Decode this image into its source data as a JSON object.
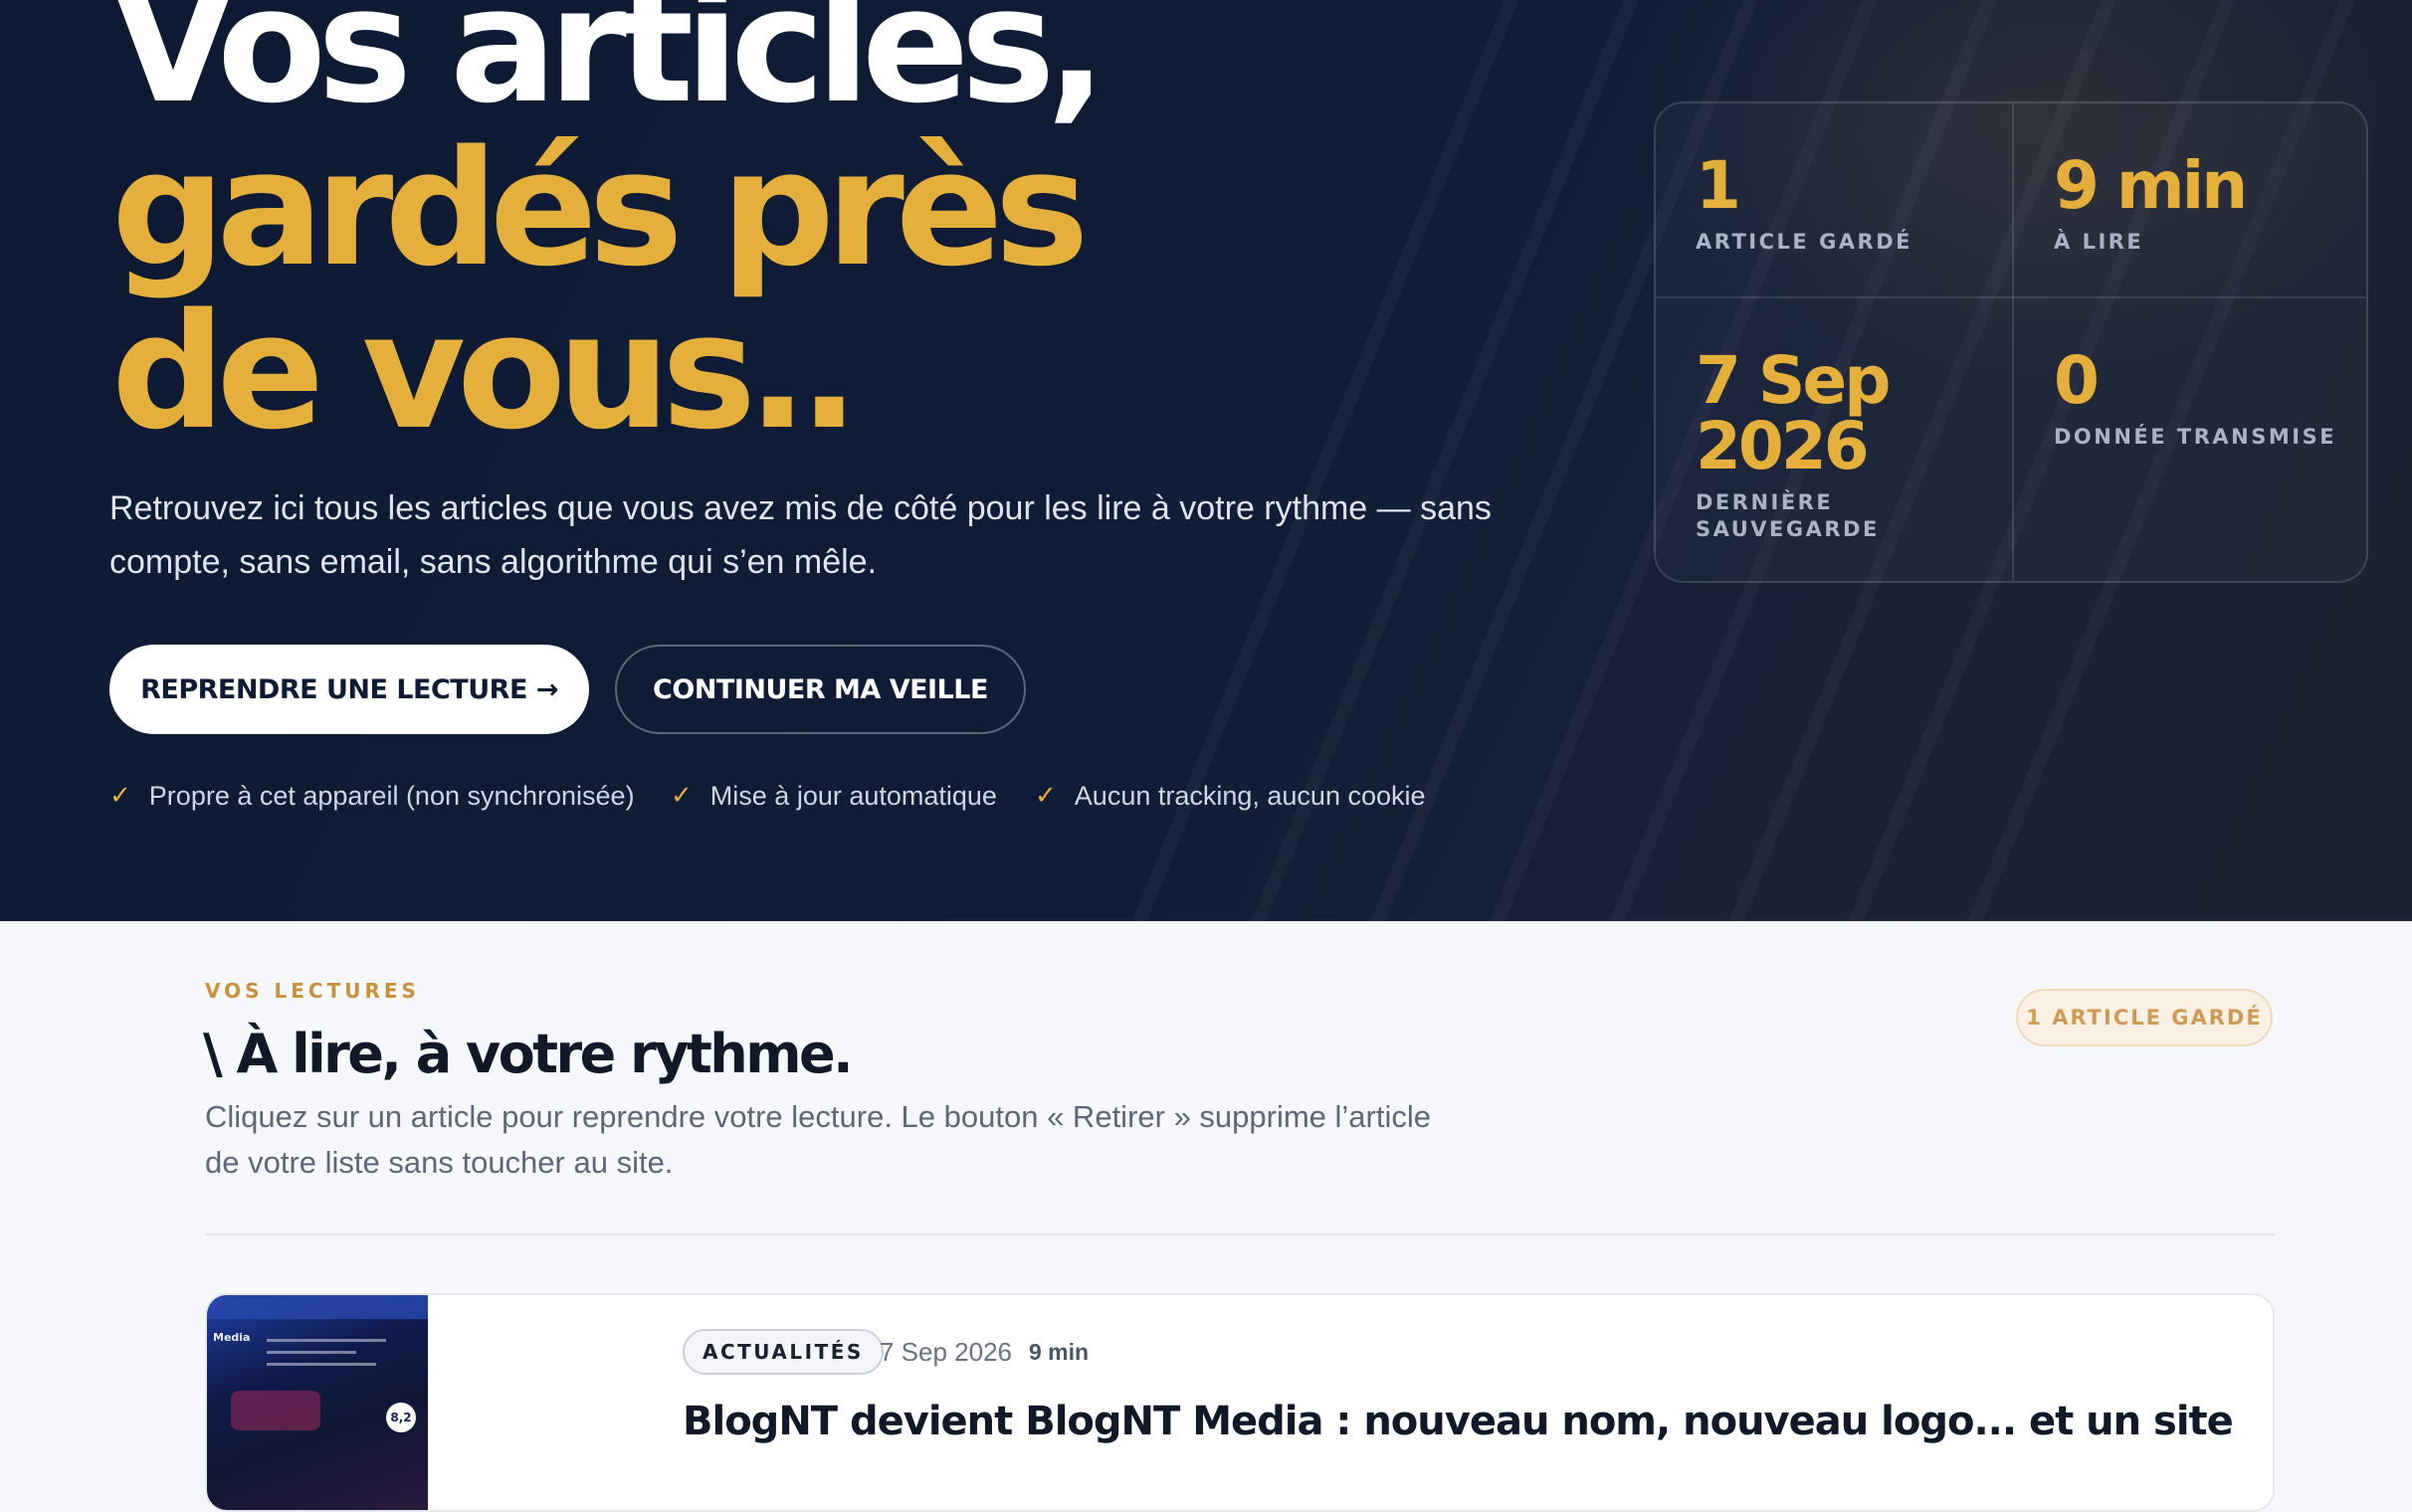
{
  "hero": {
    "title_line1": "Vos articles,",
    "title_line2": "gardés près",
    "title_line3": "de vous..",
    "description": "Retrouvez ici tous les articles que vous avez mis de côté pour les lire à votre rythme — sans compte, sans email, sans algorithme qui s’en mêle.",
    "primary_button": "REPRENDRE UNE LECTURE →",
    "secondary_button": "CONTINUER MA VEILLE",
    "features": [
      "Propre à cet appareil (non synchronisée)",
      "Mise à jour automatique",
      "Aucun tracking, aucun cookie"
    ]
  },
  "stats": [
    {
      "value": "1",
      "label": "Article gardé"
    },
    {
      "value": "9 min",
      "label": "À lire"
    },
    {
      "value": "7 Sep 2026",
      "label": "Dernière sauvegarde"
    },
    {
      "value": "0",
      "label": "Donnée transmise"
    }
  ],
  "section": {
    "eyebrow": "VOS LECTURES",
    "title": "\\ À lire, à votre rythme.",
    "description": "Cliquez sur un article pour reprendre votre lecture. Le bouton « Retirer » supprime l’article de votre liste sans toucher au site.",
    "badge": "1 ARTICLE GARDÉ"
  },
  "article": {
    "thumbnail_label": "Media",
    "thumbnail_badge": "8,2",
    "category": "ACTUALITÉS",
    "date": "7 Sep 2026",
    "read_time": "9 min",
    "title": "BlogNT devient BlogNT Media : nouveau nom, nouveau logo... et un site entièrement repensé"
  },
  "colors": {
    "hero_bg": "#0f1b33",
    "accent_gold": "#e5af3b",
    "page_bg": "#f6f8fb",
    "badge_text": "#d09a55"
  },
  "icons": [
    "check-icon",
    "arrow-right-icon"
  ]
}
